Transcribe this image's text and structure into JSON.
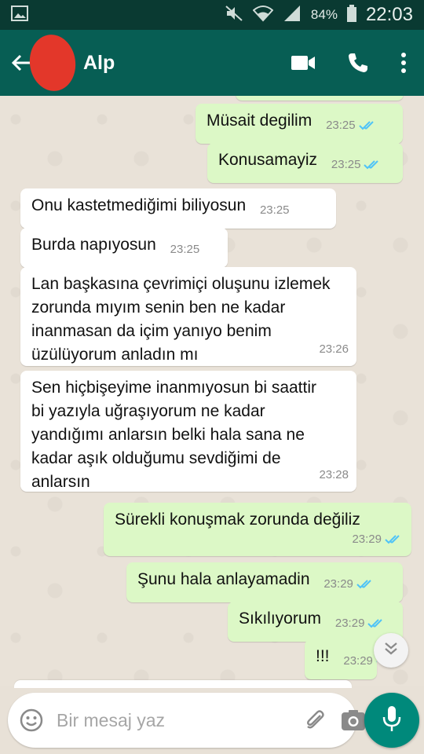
{
  "status_bar": {
    "battery": "84%",
    "time": "22:03"
  },
  "header": {
    "contact_name": "Alp"
  },
  "messages": [
    {
      "dir": "out",
      "text": "Müsait degilim",
      "time": "23:25",
      "read": true
    },
    {
      "dir": "out",
      "text": "Konusamayiz",
      "time": "23:25",
      "read": true
    },
    {
      "dir": "in",
      "text": "Onu kastetmediğimi biliyosun",
      "time": "23:25"
    },
    {
      "dir": "in",
      "text": "Burda napıyosun",
      "time": "23:25"
    },
    {
      "dir": "in",
      "text": "Lan başkasına çevrimiçi oluşunu izlemek zorunda mıyım senin ben ne kadar inanmasan da içim yanıyo benim üzülüyorum anladın mı",
      "time": "23:26"
    },
    {
      "dir": "in",
      "text": "Sen hiçbişeyime inanmıyosun bi saattir bi yazıyla uğraşıyorum ne kadar yandığımı anlarsın belki hala sana ne kadar aşık olduğumu sevdiğimi de anlarsın",
      "time": "23:28"
    },
    {
      "dir": "out",
      "text": "Sürekli konuşmak zorunda değiliz",
      "time": "23:29",
      "read": true
    },
    {
      "dir": "out",
      "text": "Şunu hala anlayamadin",
      "time": "23:29",
      "read": true
    },
    {
      "dir": "out",
      "text": "Sıkılıyorum",
      "time": "23:29",
      "read": true
    },
    {
      "dir": "out",
      "text": "!!!",
      "time": "23:29",
      "read": true
    }
  ],
  "composer": {
    "placeholder": "Bir mesaj yaz"
  },
  "colors": {
    "app_bar": "#075e54",
    "status_bar": "#0a3a32",
    "outgoing_bubble": "#dcf8c6",
    "incoming_bubble": "#ffffff",
    "read_ticks": "#4fc3f7",
    "mic_button": "#00897b"
  },
  "icons": {
    "status": [
      "gallery-icon",
      "mute-icon",
      "wifi-icon",
      "signal-icon"
    ],
    "header": [
      "back-arrow-icon",
      "video-call-icon",
      "phone-icon",
      "more-vert-icon"
    ],
    "composer": [
      "emoji-icon",
      "attach-icon",
      "camera-icon",
      "mic-icon"
    ],
    "scroll": "double-chevron-down-icon"
  }
}
